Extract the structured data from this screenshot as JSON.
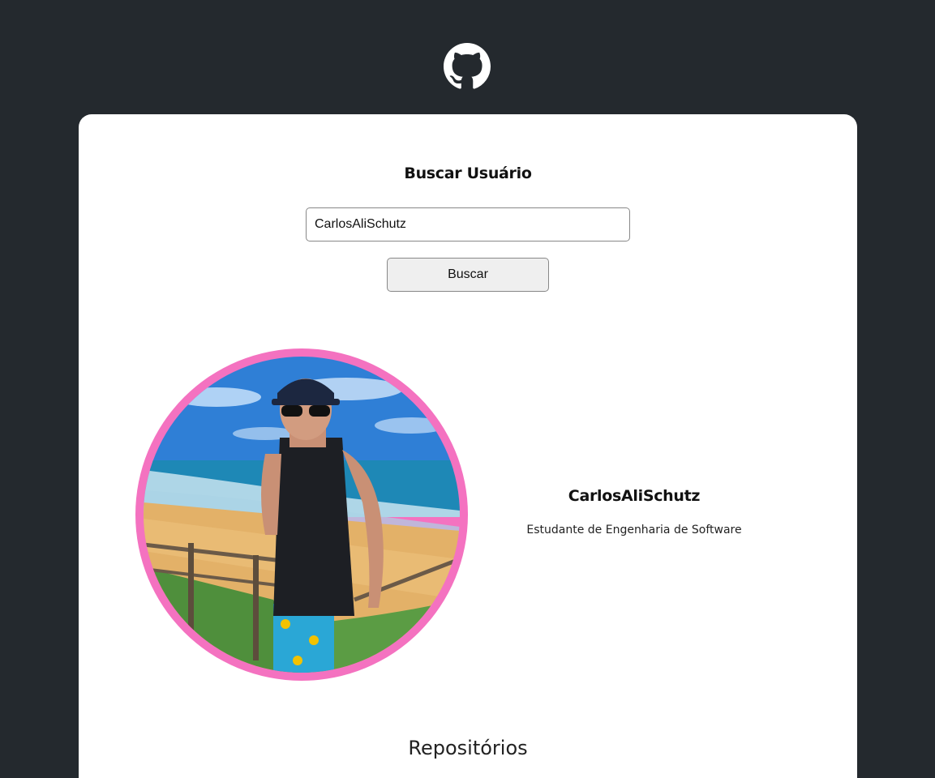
{
  "header": {
    "logo_icon": "github-icon"
  },
  "search": {
    "title": "Buscar Usuário",
    "input_value": "CarlosAliSchutz",
    "button_label": "Buscar"
  },
  "profile": {
    "name": "CarlosAliSchutz",
    "bio": "Estudante de Engenharia de Software",
    "avatar_border_color": "#f472c0"
  },
  "repositories": {
    "title": "Repositórios"
  },
  "colors": {
    "background": "#24292e",
    "card": "#ffffff",
    "accent": "#f472c0"
  }
}
